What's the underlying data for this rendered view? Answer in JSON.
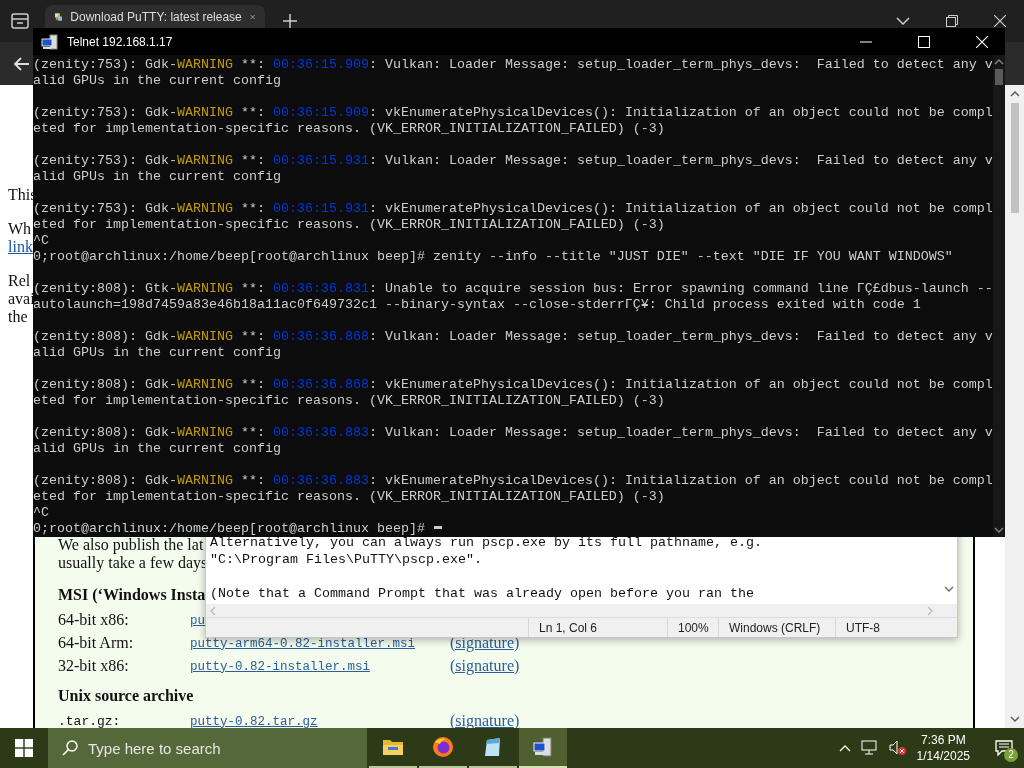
{
  "browser": {
    "tab": {
      "title": "Download PuTTY: latest release"
    },
    "page": {
      "paragraphs": [
        [
          {
            "kind": "text",
            "text": "This"
          }
        ],
        [
          {
            "kind": "text",
            "text": "Wh"
          },
          {
            "kind": "link",
            "text": "link"
          }
        ],
        [
          {
            "kind": "text",
            "text": "Rel"
          },
          {
            "kind": "text",
            "text": "avai"
          },
          {
            "kind": "text",
            "text": "the"
          }
        ]
      ],
      "frame": {
        "intro": [
          "We also publish the lat",
          "usually take a few days"
        ],
        "sections": [
          {
            "heading": "MSI (‘Windows Insta",
            "rows": [
              {
                "kind": "text",
                "label": "64-bit x86:",
                "file": "pu"
              },
              {
                "kind": "text",
                "label": "64-bit Arm:",
                "file": "putty-arm64-0.82-installer.msi",
                "signature": "(signature)"
              },
              {
                "kind": "text",
                "label": "32-bit x86:",
                "file": "putty-0.82-installer.msi",
                "signature": "(signature)"
              }
            ]
          },
          {
            "heading": "Unix source archive",
            "rows": [
              {
                "kind": "code",
                "label": ".tar.gz:",
                "file": "putty-0.82.tar.gz",
                "signature": "(signature)"
              }
            ]
          }
        ]
      }
    }
  },
  "notepad": {
    "blocks": [
      [
        "Alternatively, you can always run pscp.exe by its full pathname, e.g.",
        "\"C:\\Program Files\\PuTTY\\pscp.exe\"."
      ],
      [
        "(Note that a Command Prompt that was already open before you ran the"
      ]
    ],
    "status": [
      "Ln 1, Col 6",
      "100%",
      "Windows (CRLF)",
      "UTF-8"
    ]
  },
  "telnet": {
    "title": "Telnet 192.168.1.17",
    "blocks": [
      [
        [
          {
            "kind": "plain",
            "text": "(zenity:753): Gdk-"
          },
          {
            "kind": "warning",
            "text": "WARNING"
          },
          {
            "kind": "plain",
            "text": " **: "
          },
          {
            "kind": "time",
            "text": "00:36:15.909"
          },
          {
            "kind": "plain",
            "text": ": Vulkan: Loader Message: setup_loader_term_phys_devs:  Failed to detect any v"
          }
        ],
        [
          {
            "kind": "plain",
            "text": "alid GPUs in the current config"
          }
        ]
      ],
      [
        [
          {
            "kind": "plain",
            "text": "(zenity:753): Gdk-"
          },
          {
            "kind": "warning",
            "text": "WARNING"
          },
          {
            "kind": "plain",
            "text": " **: "
          },
          {
            "kind": "time",
            "text": "00:36:15.909"
          },
          {
            "kind": "plain",
            "text": ": vkEnumeratePhysicalDevices(): Initialization of an object could not be compl"
          }
        ],
        [
          {
            "kind": "plain",
            "text": "eted for implementation-specific reasons. (VK_ERROR_INITIALIZATION_FAILED) (-3)"
          }
        ]
      ],
      [
        [
          {
            "kind": "plain",
            "text": "(zenity:753): Gdk-"
          },
          {
            "kind": "warning",
            "text": "WARNING"
          },
          {
            "kind": "plain",
            "text": " **: "
          },
          {
            "kind": "time",
            "text": "00:36:15.931"
          },
          {
            "kind": "plain",
            "text": ": Vulkan: Loader Message: setup_loader_term_phys_devs:  Failed to detect any v"
          }
        ],
        [
          {
            "kind": "plain",
            "text": "alid GPUs in the current config"
          }
        ]
      ],
      [
        [
          {
            "kind": "plain",
            "text": "(zenity:753): Gdk-"
          },
          {
            "kind": "warning",
            "text": "WARNING"
          },
          {
            "kind": "plain",
            "text": " **: "
          },
          {
            "kind": "time",
            "text": "00:36:15.931"
          },
          {
            "kind": "plain",
            "text": ": vkEnumeratePhysicalDevices(): Initialization of an object could not be compl"
          }
        ],
        [
          {
            "kind": "plain",
            "text": "eted for implementation-specific reasons. (VK_ERROR_INITIALIZATION_FAILED) (-3)"
          }
        ],
        [
          {
            "kind": "plain",
            "text": "^C"
          }
        ],
        [
          {
            "kind": "plain",
            "text": "0;root@archlinux:/home/beep[root@archlinux beep]# zenity --info --title \"JUST DIE\" --text \"DIE IF YOU WANT WINDOWS\""
          }
        ]
      ],
      [
        [
          {
            "kind": "plain",
            "text": "(zenity:808): Gtk-"
          },
          {
            "kind": "warning",
            "text": "WARNING"
          },
          {
            "kind": "plain",
            "text": " **: "
          },
          {
            "kind": "time",
            "text": "00:36:36.831"
          },
          {
            "kind": "plain",
            "text": ": Unable to acquire session bus: Error spawning command line ΓÇ£dbus-launch --"
          }
        ],
        [
          {
            "kind": "plain",
            "text": "autolaunch=198d7459a83e46b18a11ac0f649732c1 --binary-syntax --close-stderrΓÇ¥: Child process exited with code 1"
          }
        ]
      ],
      [
        [
          {
            "kind": "plain",
            "text": "(zenity:808): Gdk-"
          },
          {
            "kind": "warning",
            "text": "WARNING"
          },
          {
            "kind": "plain",
            "text": " **: "
          },
          {
            "kind": "time",
            "text": "00:36:36.868"
          },
          {
            "kind": "plain",
            "text": ": Vulkan: Loader Message: setup_loader_term_phys_devs:  Failed to detect any v"
          }
        ],
        [
          {
            "kind": "plain",
            "text": "alid GPUs in the current config"
          }
        ]
      ],
      [
        [
          {
            "kind": "plain",
            "text": "(zenity:808): Gdk-"
          },
          {
            "kind": "warning",
            "text": "WARNING"
          },
          {
            "kind": "plain",
            "text": " **: "
          },
          {
            "kind": "time",
            "text": "00:36:36.868"
          },
          {
            "kind": "plain",
            "text": ": vkEnumeratePhysicalDevices(): Initialization of an object could not be compl"
          }
        ],
        [
          {
            "kind": "plain",
            "text": "eted for implementation-specific reasons. (VK_ERROR_INITIALIZATION_FAILED) (-3)"
          }
        ]
      ],
      [
        [
          {
            "kind": "plain",
            "text": "(zenity:808): Gdk-"
          },
          {
            "kind": "warning",
            "text": "WARNING"
          },
          {
            "kind": "plain",
            "text": " **: "
          },
          {
            "kind": "time",
            "text": "00:36:36.883"
          },
          {
            "kind": "plain",
            "text": ": Vulkan: Loader Message: setup_loader_term_phys_devs:  Failed to detect any v"
          }
        ],
        [
          {
            "kind": "plain",
            "text": "alid GPUs in the current config"
          }
        ]
      ],
      [
        [
          {
            "kind": "plain",
            "text": "(zenity:808): Gdk-"
          },
          {
            "kind": "warning",
            "text": "WARNING"
          },
          {
            "kind": "plain",
            "text": " **: "
          },
          {
            "kind": "time",
            "text": "00:36:36.883"
          },
          {
            "kind": "plain",
            "text": ": vkEnumeratePhysicalDevices(): Initialization of an object could not be compl"
          }
        ],
        [
          {
            "kind": "plain",
            "text": "eted for implementation-specific reasons. (VK_ERROR_INITIALIZATION_FAILED) (-3)"
          }
        ],
        [
          {
            "kind": "plain",
            "text": "^C"
          }
        ],
        [
          {
            "kind": "plain",
            "text": "0;root@archlinux:/home/beep[root@archlinux beep]# "
          }
        ]
      ]
    ]
  },
  "taskbar": {
    "search": {
      "placeholder": "Type here to search"
    },
    "apps": [
      {
        "kind": "folder",
        "selected": false
      },
      {
        "kind": "firefox",
        "selected": false
      },
      {
        "kind": "notepad",
        "selected": false
      },
      {
        "kind": "telnet",
        "selected": true
      }
    ],
    "tray": {
      "volume_muted": true,
      "time": "7:36 PM",
      "date": "1/14/2025",
      "notifications": "2"
    }
  }
}
